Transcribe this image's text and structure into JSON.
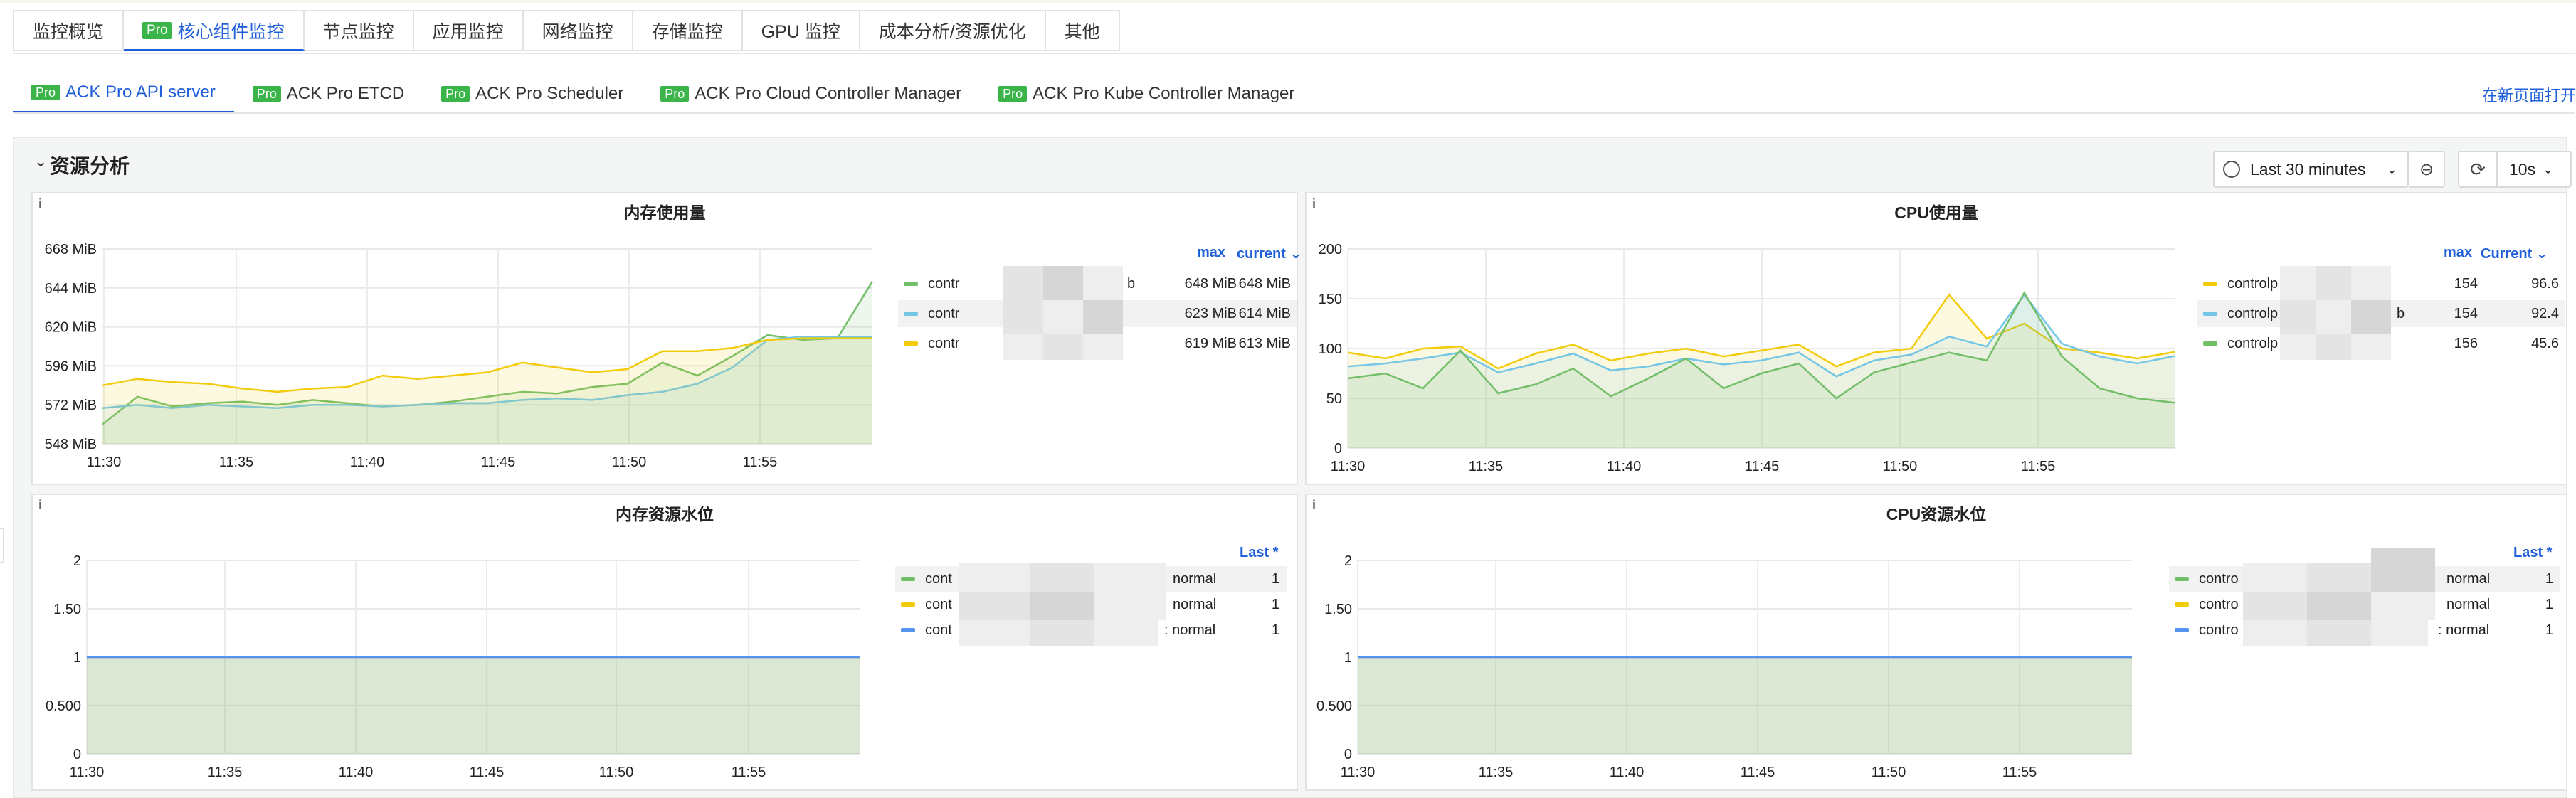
{
  "tabs": [
    {
      "label": "监控概览",
      "pro": false,
      "active": false
    },
    {
      "label": "核心组件监控",
      "pro": true,
      "active": true
    },
    {
      "label": "节点监控",
      "pro": false,
      "active": false
    },
    {
      "label": "应用监控",
      "pro": false,
      "active": false
    },
    {
      "label": "网络监控",
      "pro": false,
      "active": false
    },
    {
      "label": "存储监控",
      "pro": false,
      "active": false
    },
    {
      "label": "GPU 监控",
      "pro": false,
      "active": false
    },
    {
      "label": "成本分析/资源优化",
      "pro": false,
      "active": false
    },
    {
      "label": "其他",
      "pro": false,
      "active": false
    }
  ],
  "pro_badge": "Pro",
  "subtabs": [
    {
      "label": "ACK Pro API server",
      "active": true
    },
    {
      "label": "ACK Pro ETCD",
      "active": false
    },
    {
      "label": "ACK Pro Scheduler",
      "active": false
    },
    {
      "label": "ACK Pro Cloud Controller Manager",
      "active": false
    },
    {
      "label": "ACK Pro Kube Controller Manager",
      "active": false
    }
  ],
  "open_new_page": "在新页面打开",
  "row": {
    "title": "资源分析",
    "chevron": "›"
  },
  "toolbar": {
    "time_range": "Last 30 minutes",
    "refresh_interval": "10s"
  },
  "icons": {
    "clock": "clock-icon",
    "zoom_out": "zoom-out-icon",
    "refresh": "refresh-icon",
    "info": "info-icon",
    "chevron": "chevron-down-icon"
  },
  "colors": {
    "green": "#73bf69",
    "blue": "#73c6e6",
    "yellow": "#f2cc0c",
    "lineblue": "#5794f2",
    "accent": "#1f5fd9"
  },
  "panels": {
    "mem": {
      "title": "内存使用量",
      "info": "i",
      "legend_headers": [
        "max",
        "current ⌄"
      ],
      "legend": [
        {
          "name": "contr",
          "tail": "b",
          "max": "648 MiB",
          "current": "648 MiB",
          "color": "#73bf69"
        },
        {
          "name": "contr",
          "tail": "",
          "max": "623 MiB",
          "current": "614 MiB",
          "color": "#73c6e6"
        },
        {
          "name": "contr",
          "tail": "",
          "max": "619 MiB",
          "current": "613 MiB",
          "color": "#f2cc0c"
        }
      ]
    },
    "cpu": {
      "title": "CPU使用量",
      "info": "i",
      "legend_headers": [
        "max",
        "Current ⌄"
      ],
      "legend": [
        {
          "name": "controlp",
          "tail": "",
          "max": "154",
          "current": "96.6",
          "color": "#f2cc0c"
        },
        {
          "name": "controlp",
          "tail": "b",
          "max": "154",
          "current": "92.4",
          "color": "#73c6e6"
        },
        {
          "name": "controlp",
          "tail": "",
          "max": "156",
          "current": "45.6",
          "color": "#73bf69"
        }
      ]
    },
    "memlevel": {
      "title": "内存资源水位",
      "info": "i",
      "legend_headers": [
        "Last *"
      ],
      "legend": [
        {
          "name": "cont",
          "tail": "normal",
          "last": "1",
          "color": "#73bf69"
        },
        {
          "name": "cont",
          "tail": "normal",
          "last": "1",
          "color": "#f2cc0c"
        },
        {
          "name": "cont",
          "tail": ": normal",
          "last": "1",
          "color": "#5794f2"
        }
      ]
    },
    "cpulevel": {
      "title": "CPU资源水位",
      "info": "i",
      "legend_headers": [
        "Last *"
      ],
      "legend": [
        {
          "name": "contro",
          "tail": "normal",
          "last": "1",
          "color": "#73bf69"
        },
        {
          "name": "contro",
          "tail": "normal",
          "last": "1",
          "color": "#f2cc0c"
        },
        {
          "name": "contro",
          "tail": ": normal",
          "last": "1",
          "color": "#5794f2"
        }
      ]
    }
  },
  "chart_data": [
    {
      "type": "line",
      "title": "内存使用量",
      "x": [
        "11:30",
        "11:35",
        "11:40",
        "11:45",
        "11:50",
        "11:55"
      ],
      "yticks": [
        "548 MiB",
        "572 MiB",
        "596 MiB",
        "620 MiB",
        "644 MiB",
        "668 MiB"
      ],
      "ylim": [
        548,
        668
      ],
      "series": [
        {
          "values": [
            560,
            577,
            571,
            573,
            574,
            572,
            575,
            573,
            571,
            572,
            574,
            577,
            580,
            579,
            583,
            585,
            598,
            590,
            602,
            615,
            612,
            613,
            648
          ]
        },
        {
          "values": [
            570,
            572,
            570,
            572,
            571,
            570,
            572,
            572,
            571,
            572,
            573,
            573,
            575,
            576,
            575,
            578,
            580,
            585,
            595,
            612,
            614,
            614,
            614
          ]
        },
        {
          "values": [
            584,
            588,
            586,
            585,
            582,
            580,
            582,
            583,
            590,
            588,
            590,
            592,
            598,
            595,
            592,
            594,
            605,
            605,
            607,
            612,
            613,
            613,
            613
          ]
        }
      ]
    },
    {
      "type": "line",
      "title": "CPU使用量",
      "x": [
        "11:30",
        "11:35",
        "11:40",
        "11:45",
        "11:50",
        "11:55"
      ],
      "yticks": [
        "0",
        "50",
        "100",
        "150",
        "200"
      ],
      "ylim": [
        0,
        200
      ],
      "series": [
        {
          "values": [
            96,
            90,
            100,
            102,
            80,
            95,
            104,
            88,
            95,
            100,
            92,
            98,
            104,
            82,
            96,
            100,
            154,
            110,
            125,
            100,
            96,
            90,
            96.6
          ]
        },
        {
          "values": [
            82,
            85,
            90,
            96,
            76,
            85,
            95,
            78,
            82,
            90,
            84,
            88,
            96,
            72,
            88,
            94,
            112,
            102,
            154,
            105,
            92,
            85,
            92.4
          ]
        },
        {
          "values": [
            70,
            75,
            60,
            98,
            55,
            64,
            80,
            52,
            70,
            90,
            60,
            75,
            85,
            50,
            76,
            86,
            96,
            88,
            156,
            92,
            60,
            50,
            45.6
          ]
        }
      ]
    },
    {
      "type": "line",
      "title": "内存资源水位",
      "x": [
        "11:30",
        "11:35",
        "11:40",
        "11:45",
        "11:50",
        "11:55"
      ],
      "yticks": [
        "0",
        "0.500",
        "1",
        "1.50",
        "2"
      ],
      "ylim": [
        0,
        2
      ],
      "series": [
        {
          "values": [
            1,
            1
          ]
        },
        {
          "values": [
            1,
            1
          ]
        },
        {
          "values": [
            1,
            1
          ]
        }
      ]
    },
    {
      "type": "line",
      "title": "CPU资源水位",
      "x": [
        "11:30",
        "11:35",
        "11:40",
        "11:45",
        "11:50",
        "11:55"
      ],
      "yticks": [
        "0",
        "0.500",
        "1",
        "1.50",
        "2"
      ],
      "ylim": [
        0,
        2
      ],
      "series": [
        {
          "values": [
            1,
            1
          ]
        },
        {
          "values": [
            1,
            1
          ]
        },
        {
          "values": [
            1,
            1
          ]
        }
      ]
    }
  ]
}
